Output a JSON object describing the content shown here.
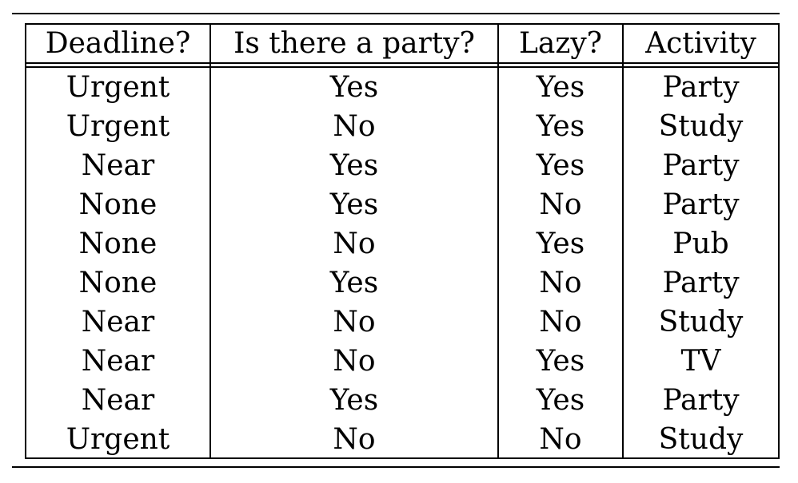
{
  "table": {
    "headers": [
      "Deadline?",
      "Is there a party?",
      "Lazy?",
      "Activity"
    ],
    "rows": [
      [
        "Urgent",
        "Yes",
        "Yes",
        "Party"
      ],
      [
        "Urgent",
        "No",
        "Yes",
        "Study"
      ],
      [
        "Near",
        "Yes",
        "Yes",
        "Party"
      ],
      [
        "None",
        "Yes",
        "No",
        "Party"
      ],
      [
        "None",
        "No",
        "Yes",
        "Pub"
      ],
      [
        "None",
        "Yes",
        "No",
        "Party"
      ],
      [
        "Near",
        "No",
        "No",
        "Study"
      ],
      [
        "Near",
        "No",
        "Yes",
        "TV"
      ],
      [
        "Near",
        "Yes",
        "Yes",
        "Party"
      ],
      [
        "Urgent",
        "No",
        "No",
        "Study"
      ]
    ]
  }
}
